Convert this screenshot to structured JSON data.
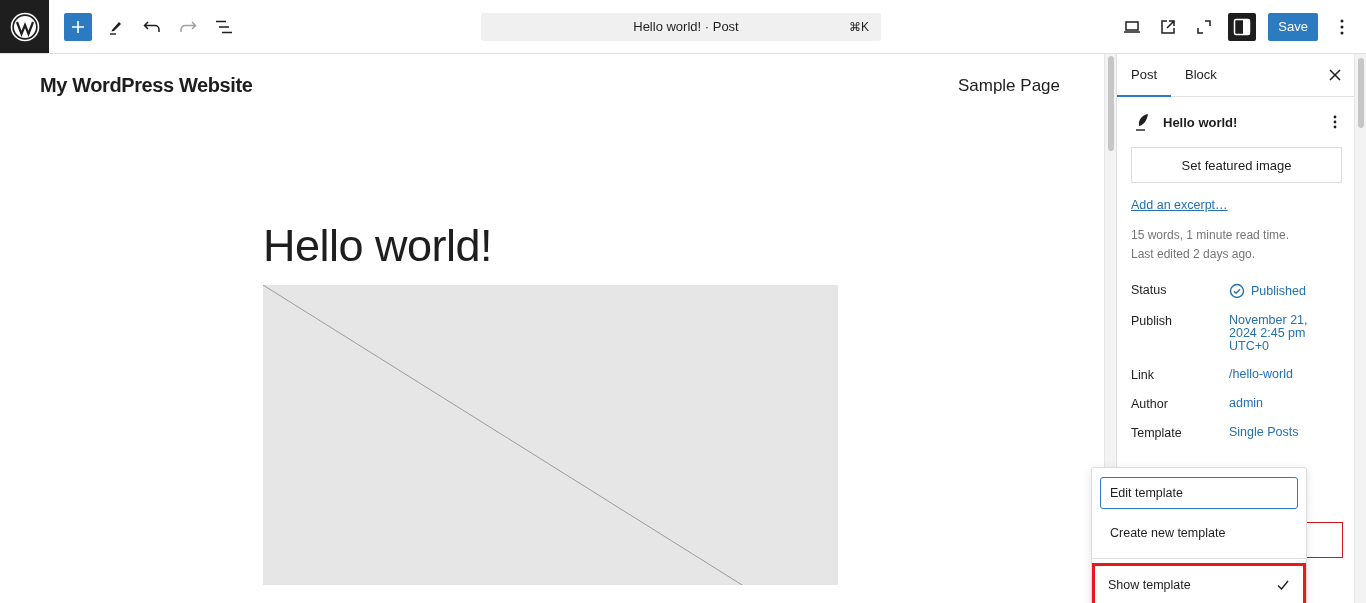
{
  "toolbar": {
    "command_bar": {
      "title": "Hello world! · Post",
      "shortcut": "⌘K"
    },
    "save_label": "Save",
    "sidebar_toggle_on": true
  },
  "site": {
    "title": "My WordPress Website",
    "nav": [
      "Sample Page"
    ]
  },
  "post": {
    "title": "Hello world!"
  },
  "sidebar": {
    "tabs": [
      {
        "label": "Post",
        "selected": true
      },
      {
        "label": "Block",
        "selected": false
      }
    ],
    "post_title": "Hello world!",
    "featured_image_label": "Set featured image",
    "excerpt_link": "Add an excerpt…",
    "stats": [
      "15 words, 1 minute read time.",
      "Last edited 2 days ago."
    ],
    "meta": [
      {
        "label": "Status",
        "value": "Published",
        "kind": "status"
      },
      {
        "label": "Publish",
        "value": "November 21, 2024 2:45 pm UTC+0",
        "kind": "plain"
      },
      {
        "label": "Link",
        "value": "/hello-world",
        "kind": "plain"
      },
      {
        "label": "Author",
        "value": "admin",
        "kind": "plain"
      },
      {
        "label": "Template",
        "value": "Single Posts",
        "kind": "plain"
      }
    ]
  },
  "template_menu": {
    "groups": [
      [
        {
          "label": "Edit template",
          "focused": true,
          "checked": false,
          "highlighted": false
        },
        {
          "label": "Create new template",
          "focused": false,
          "checked": false,
          "highlighted": false
        }
      ],
      [
        {
          "label": "Show template",
          "focused": false,
          "checked": true,
          "highlighted": true
        }
      ]
    ]
  }
}
